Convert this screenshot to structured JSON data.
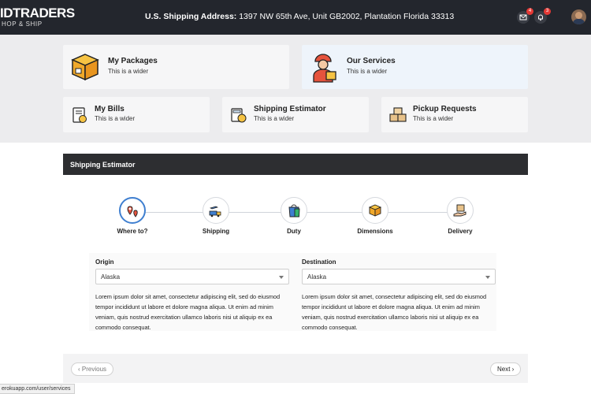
{
  "header": {
    "brand_main": "IDTRADERS",
    "brand_sub": "HOP & SHIP",
    "shipping_label": "U.S. Shipping Address:",
    "shipping_address": "1397 NW 65th Ave, Unit GB2002, Plantation Florida 33313",
    "mail_badge": "4",
    "bell_badge": "3"
  },
  "cards": [
    {
      "title": "My Packages",
      "sub": "This is a wider",
      "icon": "package-icon"
    },
    {
      "title": "Our Services",
      "sub": "This is a wider",
      "icon": "delivery-person-icon"
    },
    {
      "title": "My Bills",
      "sub": "This is a wider",
      "icon": "bill-icon"
    },
    {
      "title": "Shipping Estimator",
      "sub": "This is a wider",
      "icon": "calculator-icon"
    },
    {
      "title": "Pickup Requests",
      "sub": "This is a wider",
      "icon": "pickup-boxes-icon"
    }
  ],
  "estimator": {
    "title": "Shipping Estimator",
    "steps": [
      {
        "label": "Where to?",
        "icon": "location-pin-icon",
        "active": true
      },
      {
        "label": "Shipping",
        "icon": "shipping-vehicles-icon",
        "active": false
      },
      {
        "label": "Duty",
        "icon": "shopping-bag-icon",
        "active": false
      },
      {
        "label": "Dimensions",
        "icon": "box-dimensions-icon",
        "active": false
      },
      {
        "label": "Delivery",
        "icon": "delivery-hand-icon",
        "active": false
      }
    ],
    "origin": {
      "label": "Origin",
      "value": "Alaska"
    },
    "destination": {
      "label": "Destination",
      "value": "Alaska"
    },
    "origin_text": "Lorem ipsum dolor sit amet, consectetur adipiscing elit, sed do eiusmod tempor incididunt ut labore et dolore magna aliqua. Ut enim ad minim veniam, quis nostrud exercitation ullamco laboris nisi ut aliquip ex ea commodo consequat.",
    "destination_text": "Lorem ipsum dolor sit amet, consectetur adipiscing elit, sed do eiusmod tempor incididunt ut labore et dolore magna aliqua. Ut enim ad minim veniam, quis nostrud exercitation ullamco laboris nisi ut aliquip ex ea commodo consequat.",
    "prev_label": "‹ Previous",
    "next_label": "Next ›"
  },
  "status_url": "erokuapp.com/user/services",
  "colors": {
    "accent": "#3f7fd0",
    "badge": "#e53935",
    "topbar": "#23262d"
  }
}
